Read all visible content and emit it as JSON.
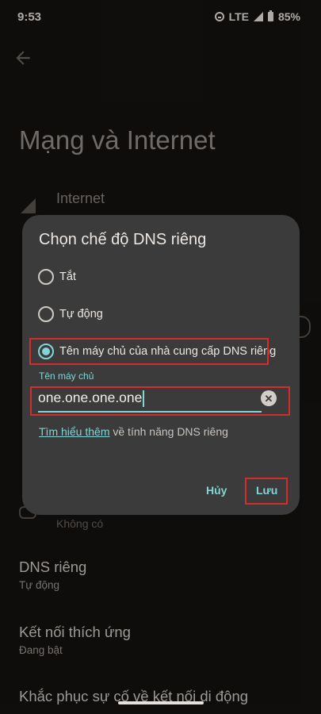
{
  "status": {
    "time": "9:53",
    "network": "LTE",
    "battery": "85%"
  },
  "page": {
    "title": "Mạng và Internet",
    "internet_label": "Internet",
    "none_label": "Không có"
  },
  "dialog": {
    "title": "Chọn chế độ DNS riêng",
    "options": [
      {
        "label": "Tắt",
        "selected": false
      },
      {
        "label": "Tự động",
        "selected": false
      },
      {
        "label": "Tên máy chủ của nhà cung cấp DNS riêng",
        "selected": true
      }
    ],
    "hostname_label": "Tên máy chủ",
    "hostname_value": "one.one.one.one",
    "learn_link": "Tìm hiểu thêm",
    "learn_rest": " về tính năng DNS riêng",
    "cancel_label": "Hủy",
    "save_label": "Lưu"
  },
  "list": [
    {
      "title": "DNS riêng",
      "subtitle": "Tự động"
    },
    {
      "title": "Kết nối thích ứng",
      "subtitle": "Đang bật"
    },
    {
      "title": "Khắc phục sự cố về kết nối di động",
      "subtitle": ""
    }
  ],
  "colors": {
    "accent": "#83d4d4",
    "highlight": "#d42b2b",
    "dialog_bg": "#3b3b3b"
  }
}
